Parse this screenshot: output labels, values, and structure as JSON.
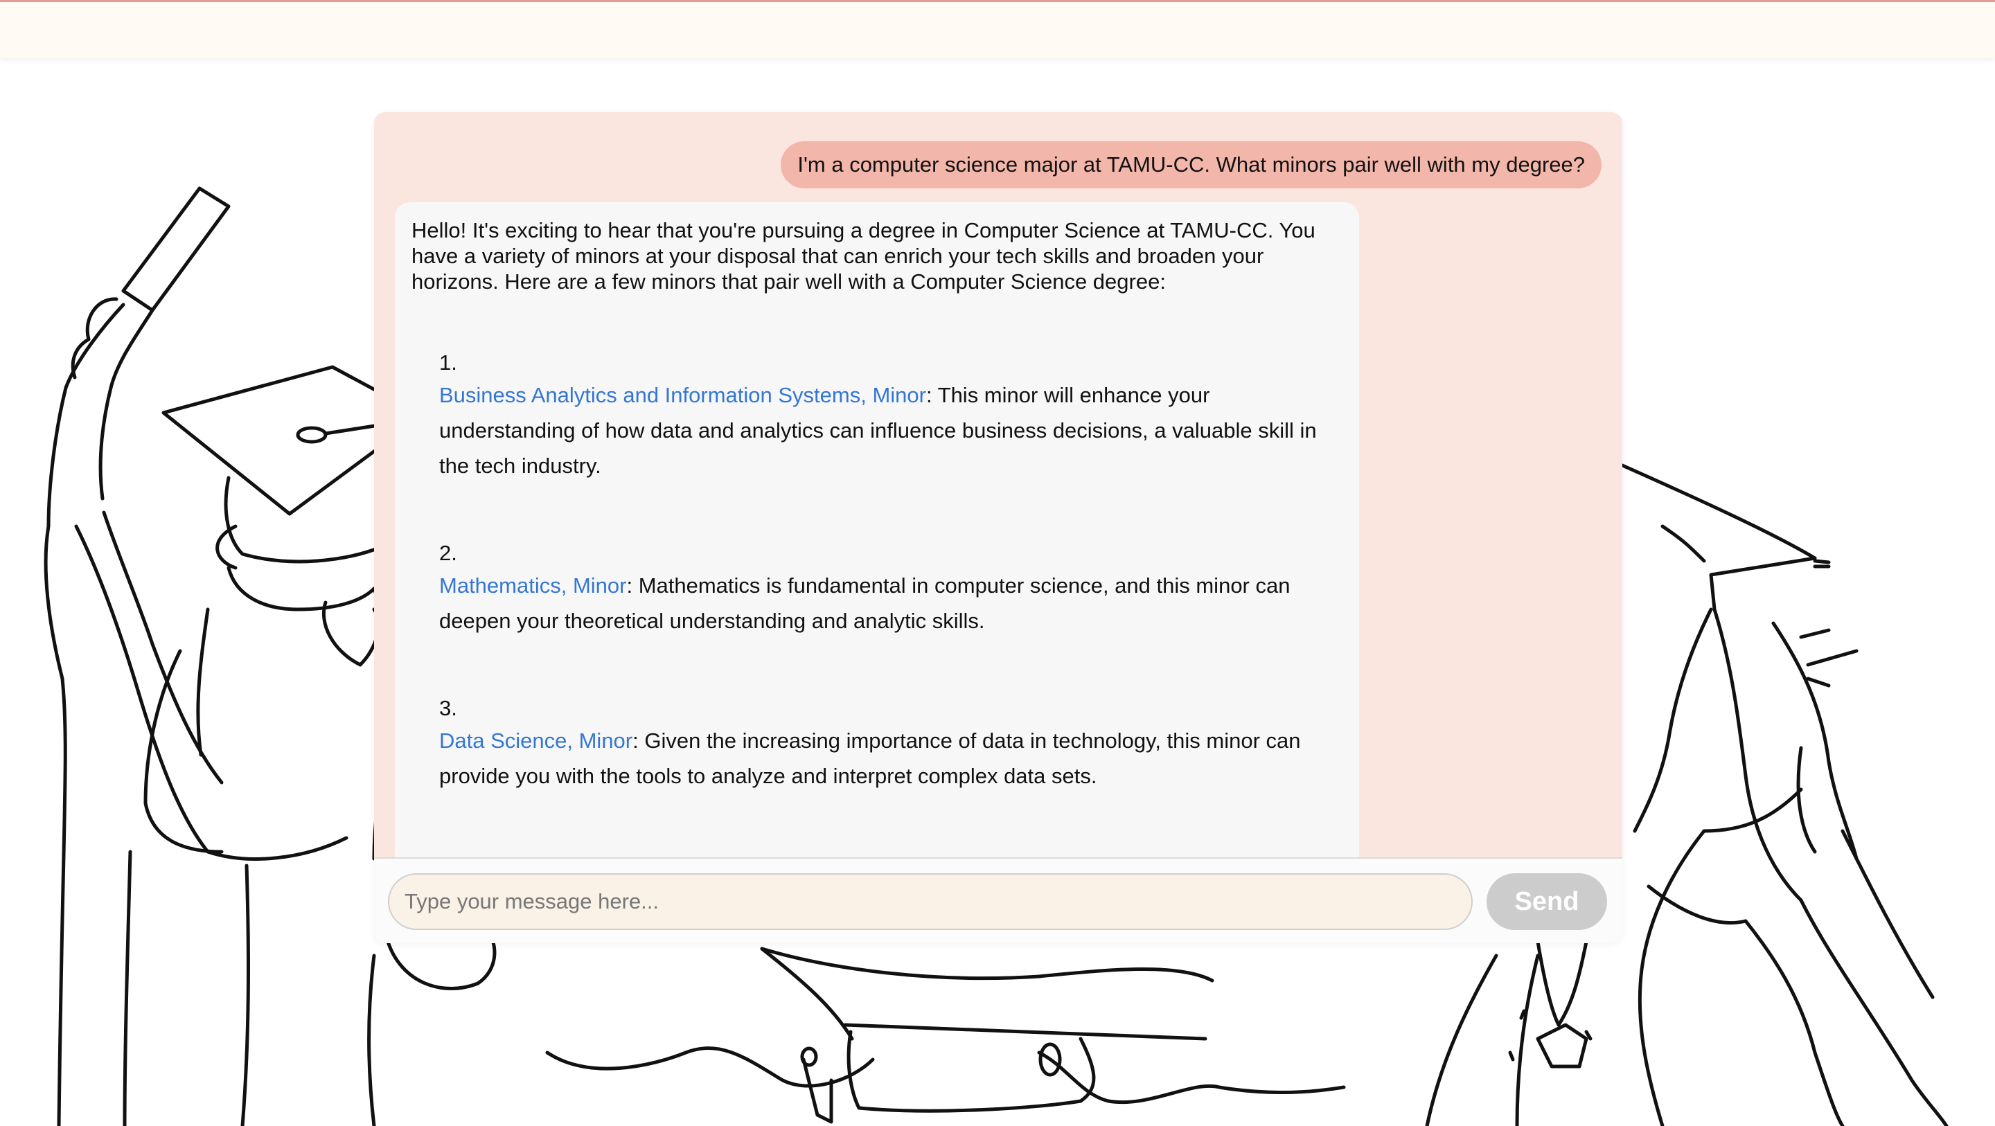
{
  "chat": {
    "user_message": "I'm a computer science major at TAMU-CC. What minors pair well with my degree?",
    "bot_intro": "Hello! It's exciting to hear that you're pursuing a degree in Computer Science at TAMU-CC. You have a variety of minors at your disposal that can enrich your tech skills and broaden your horizons. Here are a few minors that pair well with a Computer Science degree:",
    "items": [
      {
        "number": "1.",
        "link": "Business Analytics and Information Systems, Minor",
        "text": ": This minor will enhance your understanding of how data and analytics can influence business decisions, a valuable skill in the tech industry."
      },
      {
        "number": "2.",
        "link": "Mathematics, Minor",
        "text": ": Mathematics is fundamental in computer science, and this minor can deepen your theoretical understanding and analytic skills."
      },
      {
        "number": "3.",
        "link": "Data Science, Minor",
        "text": ": Given the increasing importance of data in technology, this minor can provide you with the tools to analyze and interpret complex data sets."
      }
    ]
  },
  "input": {
    "placeholder": "Type your message here...",
    "value": ""
  },
  "send_label": "Send",
  "colors": {
    "header_bg": "#fffaf4",
    "header_border": "#e59a9a",
    "chat_bg": "#fae6df",
    "user_bubble": "#f3b6aa",
    "bot_bubble": "#f7f7f7",
    "link": "#3476d4",
    "input_bg": "#faf2e6",
    "send_button": "#cccccc"
  }
}
